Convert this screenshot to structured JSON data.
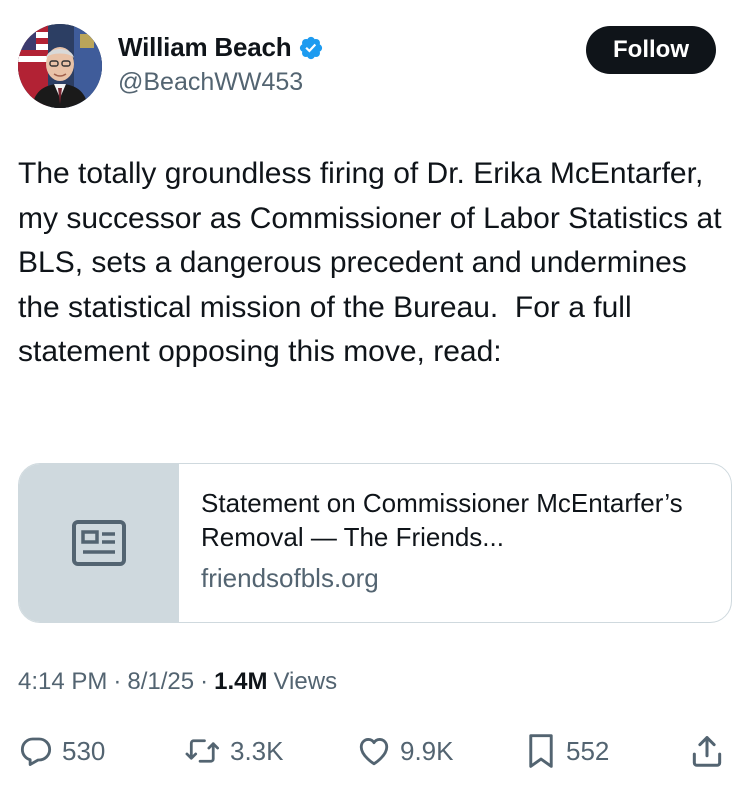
{
  "author": {
    "display_name": "William Beach",
    "handle": "@BeachWW453",
    "verified": true
  },
  "follow_label": "Follow",
  "tweet": {
    "text": "The totally groundless firing of Dr. Erika McEntarfer, my successor as Commissioner of Labor Statistics at BLS, sets a dangerous precedent and undermines the statistical mission of the Bureau.  For a full statement opposing this move, read:"
  },
  "link_card": {
    "title": "Statement on Commissioner McEntarfer’s Removal — The Friends...",
    "domain": "friendsofbls.org",
    "icon": "article-icon"
  },
  "meta": {
    "time": "4:14 PM",
    "separator": "·",
    "date": "8/1/25",
    "views_count": "1.4M",
    "views_label": "Views"
  },
  "actions": {
    "replies": "530",
    "reposts": "3.3K",
    "likes": "9.9K",
    "bookmarks": "552"
  },
  "colors": {
    "text_primary": "#0f1419",
    "text_secondary": "#536471",
    "verified_blue": "#1d9bf0",
    "border": "#cfd9de"
  }
}
